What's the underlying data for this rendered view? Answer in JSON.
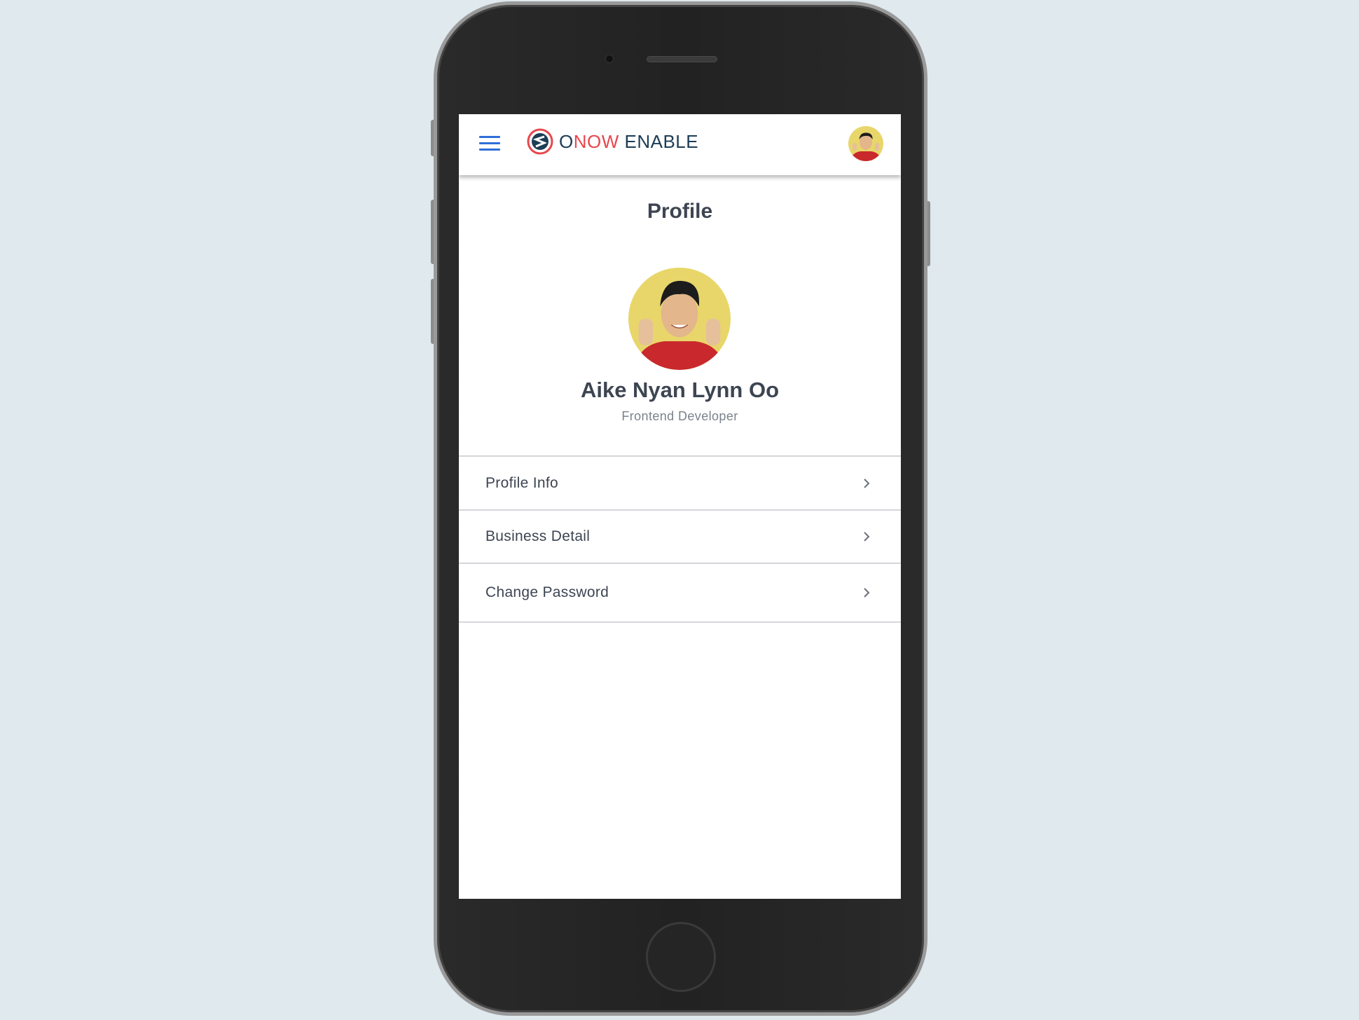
{
  "header": {
    "logo": {
      "part1": "O",
      "part2": "NOW",
      "part3": " ENABLE"
    },
    "menu_icon": "hamburger-icon",
    "avatar_icon": "user-avatar"
  },
  "page": {
    "title": "Profile",
    "user": {
      "name": "Aike Nyan Lynn Oo",
      "role": "Frontend Developer"
    },
    "menu": [
      {
        "label": "Profile Info",
        "icon": "chevron-right-icon"
      },
      {
        "label": "Business Detail",
        "icon": "chevron-right-icon"
      },
      {
        "label": "Change Password",
        "icon": "chevron-right-icon"
      }
    ]
  },
  "colors": {
    "brand_red": "#e8474c",
    "brand_navy": "#1d3d55",
    "menu_blue": "#2f6fd8",
    "text": "#3d4552"
  }
}
